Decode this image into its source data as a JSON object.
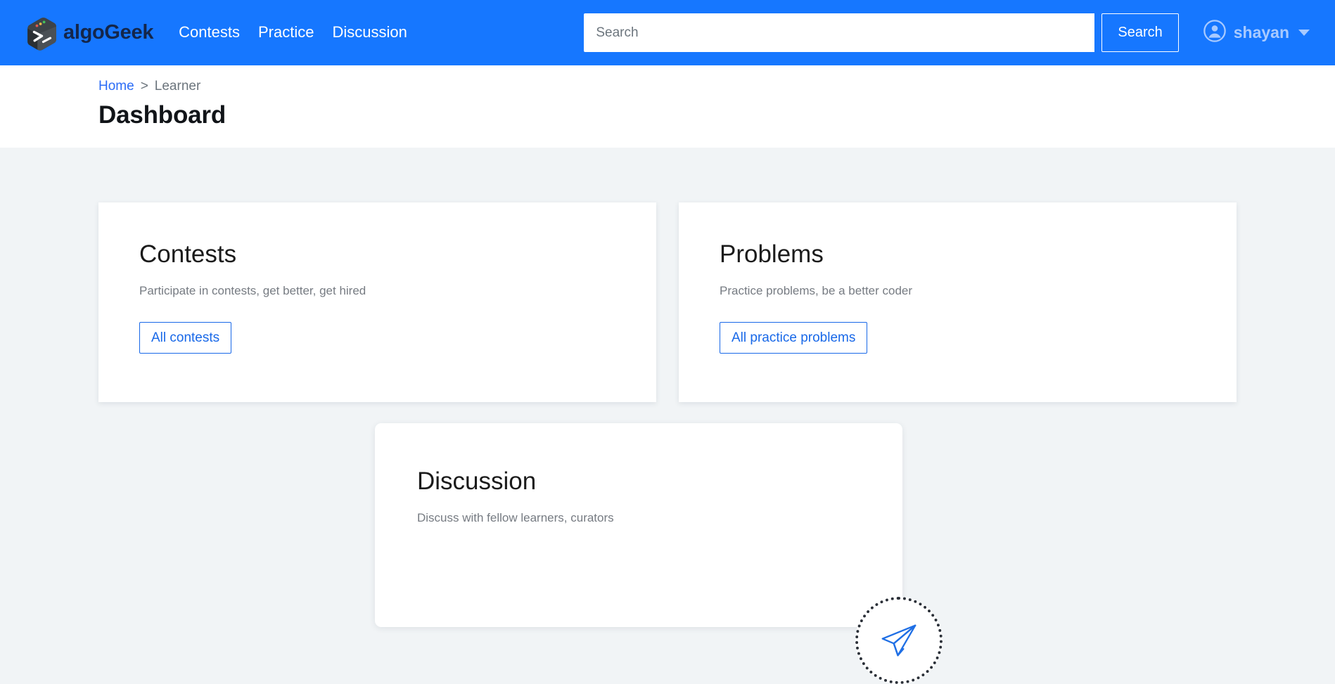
{
  "navbar": {
    "brand_name": "algoGeek",
    "brand_logo_icon": "terminal-prompt-logo-icon",
    "links": [
      {
        "label": "Contests"
      },
      {
        "label": "Practice"
      },
      {
        "label": "Discussion"
      }
    ],
    "search": {
      "value": "",
      "placeholder": "Search",
      "button_label": "Search"
    },
    "user": {
      "name": "shayan",
      "avatar_icon": "account-circle-icon",
      "caret_icon": "chevron-down-icon"
    },
    "colors": {
      "brand_blue": "#1677ff",
      "username": "#a8caff"
    }
  },
  "page_head": {
    "breadcrumb": {
      "home_label": "Home",
      "separator": ">",
      "current_label": "Learner"
    },
    "title": "Dashboard"
  },
  "main": {
    "cards": [
      {
        "title": "Contests",
        "description": "Participate in contests, get better, get hired",
        "button_label": "All contests"
      },
      {
        "title": "Problems",
        "description": "Practice problems, be a better coder",
        "button_label": "All practice problems"
      }
    ],
    "discussion_card": {
      "title": "Discussion",
      "description": "Discuss with fellow learners, curators"
    },
    "fab": {
      "icon": "paper-plane-send-icon",
      "color": "#1f6fe5"
    },
    "colors": {
      "page_bg": "#f1f4f6",
      "card_bg": "#ffffff",
      "link_blue": "#1868e8",
      "muted_text": "#767b82"
    }
  }
}
